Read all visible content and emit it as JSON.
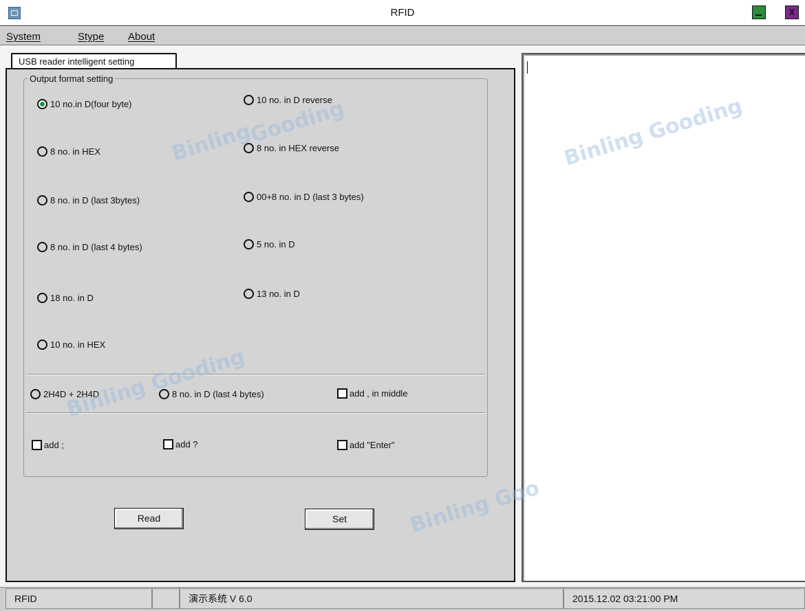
{
  "window": {
    "title": "RFID",
    "close_glyph": "X"
  },
  "menu": {
    "items": [
      {
        "label": "System"
      },
      {
        "label": "Stype"
      },
      {
        "label": "About"
      }
    ]
  },
  "tab": {
    "label": "USB reader intelligent setting"
  },
  "output_format": {
    "group_label": "Output format setting",
    "options": [
      {
        "label": "10 no.in D(four byte)",
        "checked": true
      },
      {
        "label": "10 no. in D reverse",
        "checked": false
      },
      {
        "label": "8 no. in HEX",
        "checked": false
      },
      {
        "label": "8 no. in HEX reverse",
        "checked": false
      },
      {
        "label": " 8 no. in D (last 3bytes)",
        "checked": false
      },
      {
        "label": " 00+8 no. in D (last 3 bytes)",
        "checked": false
      },
      {
        "label": "8 no. in D (last 4 bytes)",
        "checked": false
      },
      {
        "label": "5 no. in D",
        "checked": false
      },
      {
        "label": "18 no. in D",
        "checked": false
      },
      {
        "label": "13 no. in D",
        "checked": false
      },
      {
        "label": "10 no. in HEX",
        "checked": false
      }
    ],
    "extra_radios": [
      {
        "label": "2H4D + 2H4D"
      },
      {
        "label": "8 no. in D (last 4 bytes)"
      }
    ],
    "checkboxes": [
      {
        "label": "add , in middle"
      },
      {
        "label": "add ;"
      },
      {
        "label": "add ?"
      },
      {
        "label": "add \"Enter\""
      }
    ]
  },
  "buttons": {
    "read_label": "Read",
    "set_label": "Set"
  },
  "statusbar": {
    "app": "RFID",
    "empty": "",
    "version": "演示系统  V 6.0",
    "datetime": "2015.12.02   03:21:00 PM"
  },
  "watermark": {
    "text": "Binling Gooding",
    "fragment_1": "Binling",
    "fragment_2": "Gooding",
    "fragment_3": "Binling Goo",
    "color": "#96b9e1"
  },
  "colors": {
    "panel": "#d4d4d4",
    "radio_selected": "#1a9a45",
    "minimize": "#2e8b3a",
    "close": "#7a2a8a"
  }
}
